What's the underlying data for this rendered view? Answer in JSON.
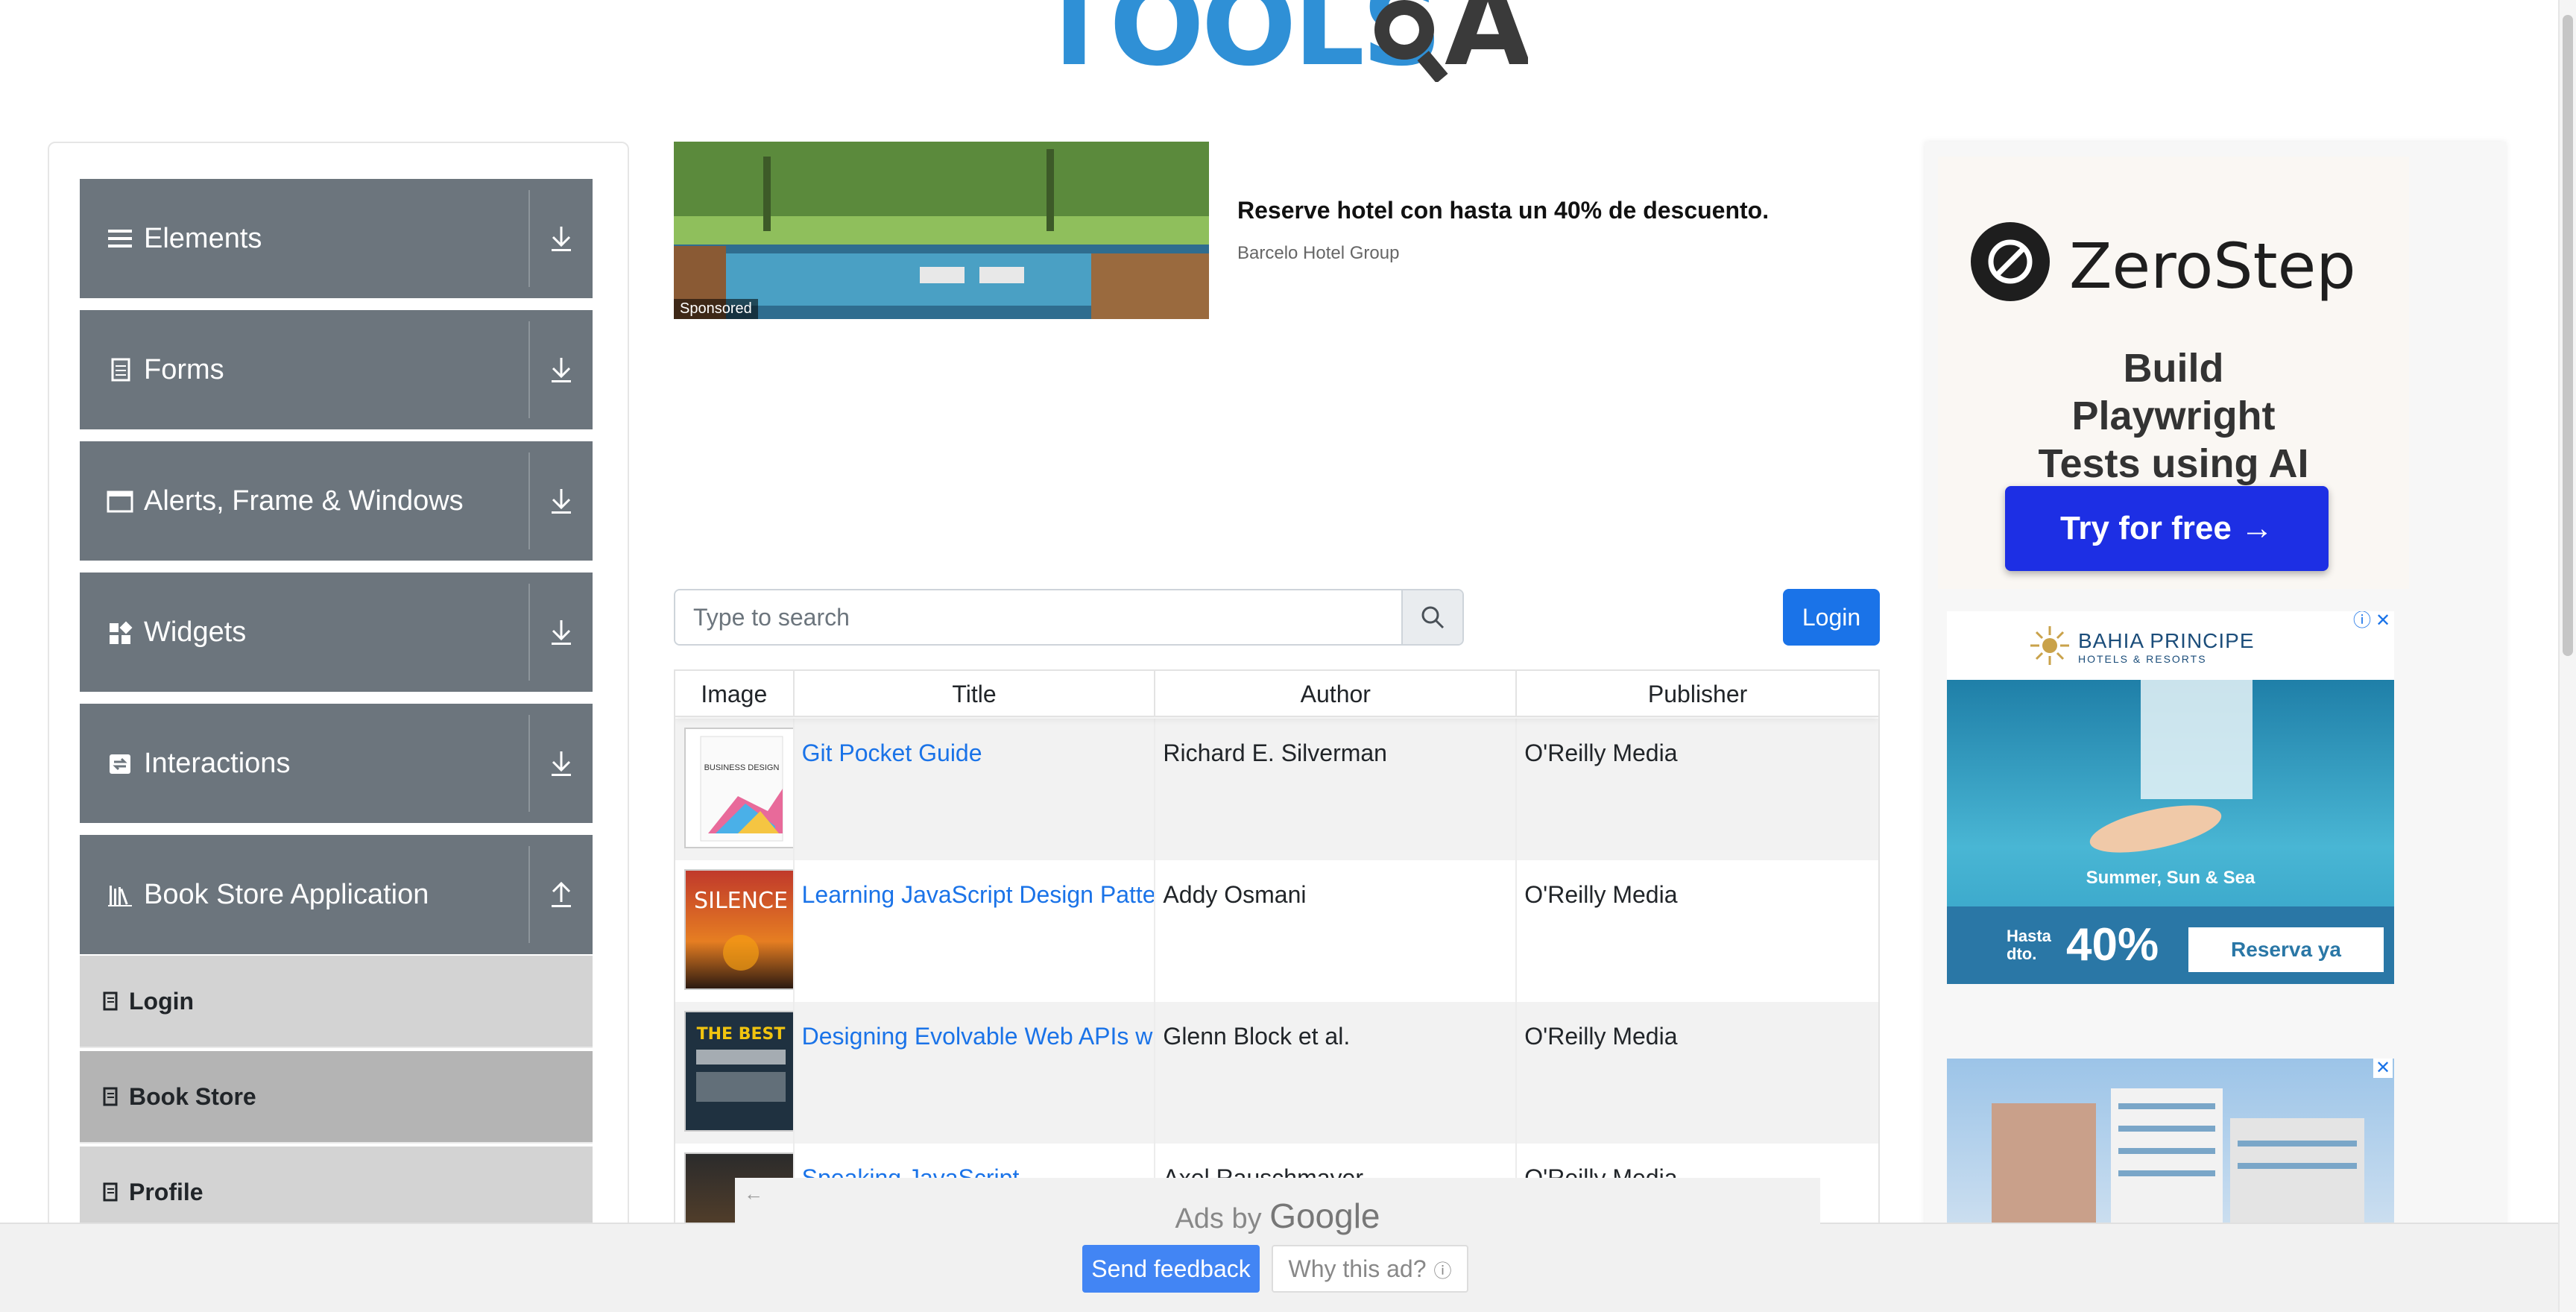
{
  "logo": {
    "text": "TOOLS",
    "suffix": "A"
  },
  "sidebar": {
    "groups": [
      {
        "label": "Elements",
        "icon": "hamburger-icon"
      },
      {
        "label": "Forms",
        "icon": "document-icon"
      },
      {
        "label": "Alerts, Frame & Windows",
        "icon": "window-icon"
      },
      {
        "label": "Widgets",
        "icon": "widgets-icon"
      },
      {
        "label": "Interactions",
        "icon": "interactions-icon"
      },
      {
        "label": "Book Store Application",
        "icon": "library-icon"
      }
    ],
    "book_store_items": [
      {
        "label": "Login",
        "active": false
      },
      {
        "label": "Book Store",
        "active": true
      },
      {
        "label": "Profile",
        "active": false
      }
    ]
  },
  "top_ad": {
    "sponsored": "Sponsored",
    "headline": "Reserve hotel con hasta un 40% de descuento.",
    "advertiser": "Barcelo Hotel Group"
  },
  "search": {
    "placeholder": "Type to search"
  },
  "login_button": "Login",
  "table": {
    "headers": [
      "Image",
      "Title",
      "Author",
      "Publisher"
    ],
    "rows": [
      {
        "title": "Git Pocket Guide",
        "author": "Richard E. Silverman",
        "publisher": "O'Reilly Media",
        "cover_text": "BUSINESS DESIGN"
      },
      {
        "title": "Learning JavaScript Design Patte",
        "author": "Addy Osmani",
        "publisher": "O'Reilly Media",
        "cover_text": "SILENCE"
      },
      {
        "title": "Designing Evolvable Web APIs wi",
        "author": "Glenn Block et al.",
        "publisher": "O'Reilly Media",
        "cover_text": "THE BEST"
      },
      {
        "title": "Speaking JavaScript",
        "author": "Axel Rauschmayer",
        "publisher": "O'Reilly Media",
        "cover_text": ""
      }
    ]
  },
  "zerostep_ad": {
    "brand": "ZeroStep",
    "tagline": "Build Playwright Tests using AI",
    "cta": "Try for free →"
  },
  "bahia_ad": {
    "brand": "BAHIA PRINCIPE",
    "brand_sub": "HOTELS & RESORTS",
    "tagline": "Summer, Sun & Sea",
    "hasta": "Hasta dto.",
    "percent": "40%",
    "cta": "Reserva ya"
  },
  "ads_by_google": {
    "prefix": "Ads by",
    "google": "Google",
    "feedback": "Send feedback",
    "why": "Why this ad?"
  },
  "colors": {
    "sidebar_header": "#6c757d",
    "menu_item": "#d3d3d3",
    "menu_item_active": "#b4b4b4",
    "link": "#1a73e8",
    "zerostep_cta": "#1d2fe4"
  }
}
